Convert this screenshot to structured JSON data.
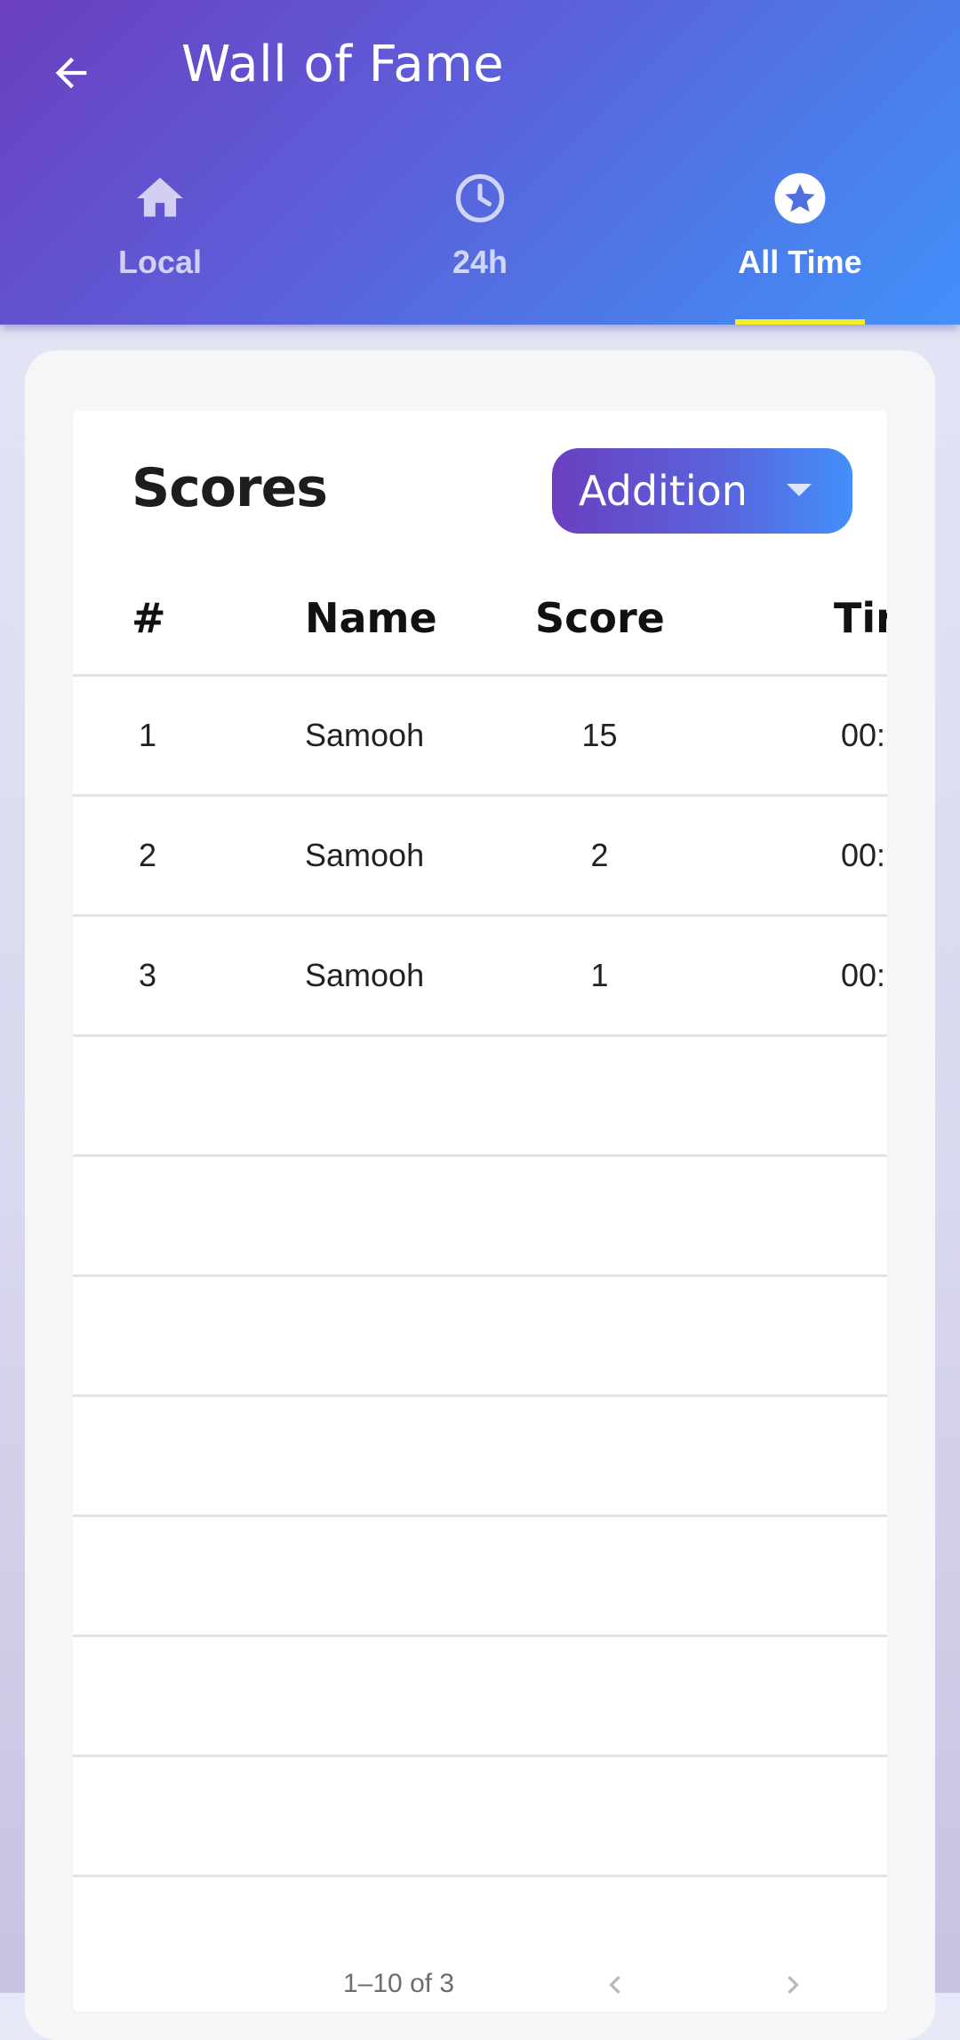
{
  "header": {
    "title": "Wall of Fame",
    "tabs": [
      {
        "label": "Local",
        "icon": "home-icon",
        "active": false
      },
      {
        "label": "24h",
        "icon": "clock-icon",
        "active": false
      },
      {
        "label": "All Time",
        "icon": "star-icon",
        "active": true
      }
    ]
  },
  "scores": {
    "title": "Scores",
    "mode_select": {
      "value": "Addition"
    },
    "columns": [
      "#",
      "Name",
      "Score",
      "Tir"
    ],
    "rows": [
      {
        "rank": "1",
        "name": "Samooh",
        "score": "15",
        "time": "00:"
      },
      {
        "rank": "2",
        "name": "Samooh",
        "score": "2",
        "time": "00:"
      },
      {
        "rank": "3",
        "name": "Samooh",
        "score": "1",
        "time": "00:"
      },
      {
        "rank": "",
        "name": "",
        "score": "",
        "time": ""
      },
      {
        "rank": "",
        "name": "",
        "score": "",
        "time": ""
      },
      {
        "rank": "",
        "name": "",
        "score": "",
        "time": ""
      },
      {
        "rank": "",
        "name": "",
        "score": "",
        "time": ""
      },
      {
        "rank": "",
        "name": "",
        "score": "",
        "time": ""
      },
      {
        "rank": "",
        "name": "",
        "score": "",
        "time": ""
      },
      {
        "rank": "",
        "name": "",
        "score": "",
        "time": ""
      }
    ],
    "pagination": {
      "range_text": "1–10 of 3"
    }
  },
  "colors": {
    "header_gradient_start": "#6a3fc0",
    "header_gradient_end": "#4390fb",
    "tab_indicator": "#f2ee2a"
  }
}
